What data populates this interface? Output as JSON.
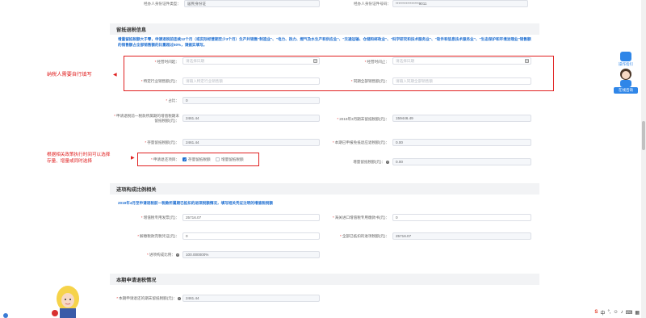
{
  "top_fields": {
    "id_type_label": "经办人身份证件类型：",
    "id_type_value": "居民身份证",
    "id_no_label": "经办人身份证件号码：",
    "id_no_value": "****************9011"
  },
  "section_conditions": {
    "title": "留抵退税信息",
    "notice": "增量留抵税额大于零，申请退税前连续12个月（或实际经营期至少3个月）生产并销售\"制造业\"、\"电力、热力、燃气及水生产和供应业\"、\"交通运输、仓储和邮政业\"、\"科学研究和技术服务业\"、\"软件和信息技术服务业\"、\"生态保护和环境治理业\"销售额的销售额占全部销售额的比重超过50%，请据实填写。",
    "start_label": "经营时间起：",
    "start_placeholder": "请选择日期",
    "end_label": "经营时间止：",
    "end_placeholder": "请选择日期",
    "industry_label": "特定行业销售额(元)：",
    "industry_placeholder": "请输入特定行业销售额",
    "total_label": "同期全部销售额(元)：",
    "total_placeholder": "请输入同期全部销售额",
    "ratio_label": "占比：",
    "ratio_value": "0",
    "prev_credit_label": "申请退税前一税款所属期的增值税期末留抵税额(元)：",
    "prev_credit_value": "2461.44",
    "march_credit_label": "2019年3月期末留抵税额(元)：",
    "march_credit_value": "159446.49",
    "stock_label": "存量留抵税额(元)：",
    "stock_value": "2461.44",
    "period_label": "本期已申报免抵退应退税额(元)：",
    "period_value": "0.00",
    "choice_label": "申请退还项目：",
    "choice_stock": "存量留抵税额",
    "choice_incr": "增量留抵税额",
    "limit_label": "增量留抵税额(元)：",
    "limit_value": "0.00"
  },
  "annotations": {
    "fill_note": "纳税人需要自行填写",
    "policy_note_line1": "根据相关政策执行时间可以选择",
    "policy_note_line2": "存量、增量或同时选择"
  },
  "section_input": {
    "title": "进项构成比例相关",
    "notice": "2019年4月至申请退税前一税款所属期已抵扣的进项税额情况，填写相关凭证注明的增值税税额",
    "vat_invoice_label": "增值税专用发票(元)：",
    "vat_invoice_value": "25716.07",
    "customs_label": "海关进口增值税专用缴款书(元)：",
    "customs_value": "0",
    "tax_receipt_label": "解缴税款完税凭证(元)：",
    "tax_receipt_value": "0",
    "all_deducted_label": "全部已抵扣的进项税额(元)：",
    "all_deducted_value": "25716.07",
    "composition_label": "进项构成比例：",
    "composition_value": "100.000000%"
  },
  "section_apply": {
    "title": "本期申请退税情况",
    "apply_label": "本期申请退还的期末留抵税额(元)：",
    "apply_value": "2461.44"
  },
  "side": {
    "guide_label": "操作指引",
    "service_label": "在线咨询"
  },
  "taskbar": {
    "ime_label": "中"
  }
}
